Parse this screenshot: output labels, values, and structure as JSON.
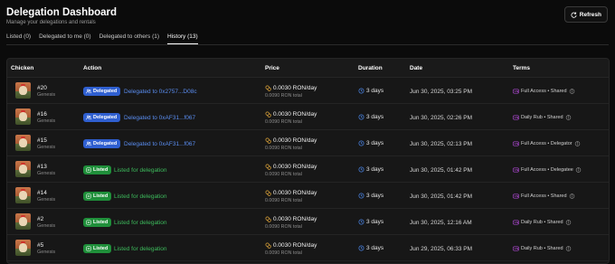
{
  "header": {
    "title": "Delegation Dashboard",
    "subtitle": "Manage your delegations and rentals",
    "refresh_label": "Refresh"
  },
  "tabs": [
    {
      "label": "Listed (0)",
      "active": false
    },
    {
      "label": "Delegated to me (0)",
      "active": false
    },
    {
      "label": "Delegated to others (1)",
      "active": false
    },
    {
      "label": "History (13)",
      "active": true
    }
  ],
  "table": {
    "columns": [
      "Chicken",
      "Action",
      "Price",
      "Duration",
      "Date",
      "Terms"
    ],
    "rows": [
      {
        "id": "#20",
        "gen": "Genesis",
        "badge": "Delegated",
        "type": "delegated",
        "action": "Delegated to 0x2757...D08c",
        "price": "0.0030 RON/day",
        "total": "0.0090 RON total",
        "duration": "3 days",
        "date": "Jun 30, 2025, 03:25 PM",
        "terms": "Full Access • Shared"
      },
      {
        "id": "#16",
        "gen": "Genesis",
        "badge": "Delegated",
        "type": "delegated",
        "action": "Delegated to 0xAF31...f067",
        "price": "0.0030 RON/day",
        "total": "0.0090 RON total",
        "duration": "3 days",
        "date": "Jun 30, 2025, 02:26 PM",
        "terms": "Daily Rub • Shared"
      },
      {
        "id": "#15",
        "gen": "Genesis",
        "badge": "Delegated",
        "type": "delegated",
        "action": "Delegated to 0xAF31...f067",
        "price": "0.0030 RON/day",
        "total": "0.0090 RON total",
        "duration": "3 days",
        "date": "Jun 30, 2025, 02:13 PM",
        "terms": "Full Access • Delegator"
      },
      {
        "id": "#13",
        "gen": "Genesis",
        "badge": "Listed",
        "type": "listed",
        "action": "Listed for delegation",
        "price": "0.0030 RON/day",
        "total": "0.0090 RON total",
        "duration": "3 days",
        "date": "Jun 30, 2025, 01:42 PM",
        "terms": "Full Access • Delegatee"
      },
      {
        "id": "#14",
        "gen": "Genesis",
        "badge": "Listed",
        "type": "listed",
        "action": "Listed for delegation",
        "price": "0.0030 RON/day",
        "total": "0.0090 RON total",
        "duration": "3 days",
        "date": "Jun 30, 2025, 01:42 PM",
        "terms": "Full Access • Shared"
      },
      {
        "id": "#2",
        "gen": "Genesis",
        "badge": "Listed",
        "type": "listed",
        "action": "Listed for delegation",
        "price": "0.0030 RON/day",
        "total": "0.0090 RON total",
        "duration": "3 days",
        "date": "Jun 30, 2025, 12:16 AM",
        "terms": "Daily Rub • Shared"
      },
      {
        "id": "#5",
        "gen": "Genesis",
        "badge": "Listed",
        "type": "listed",
        "action": "Listed for delegation",
        "price": "0.0030 RON/day",
        "total": "0.0090 RON total",
        "duration": "3 days",
        "date": "Jun 29, 2025, 06:33 PM",
        "terms": "Daily Rub • Shared"
      }
    ]
  },
  "icons": {
    "refresh": "refresh-icon",
    "delegated_badge": "users-icon",
    "listed_badge": "list-icon",
    "price": "coins-icon",
    "duration": "clock-icon",
    "terms": "gamepad-icon",
    "info": "info-icon"
  },
  "colors": {
    "background": "#0b0b0b",
    "delegated": "#2f5fd0",
    "delegated_text": "#5a8df0",
    "listed": "#1f8f3a",
    "listed_text": "#3dbb5c",
    "coin": "#e0a63a",
    "clock": "#4a86e8",
    "terms_icon": "#b24ad8"
  }
}
